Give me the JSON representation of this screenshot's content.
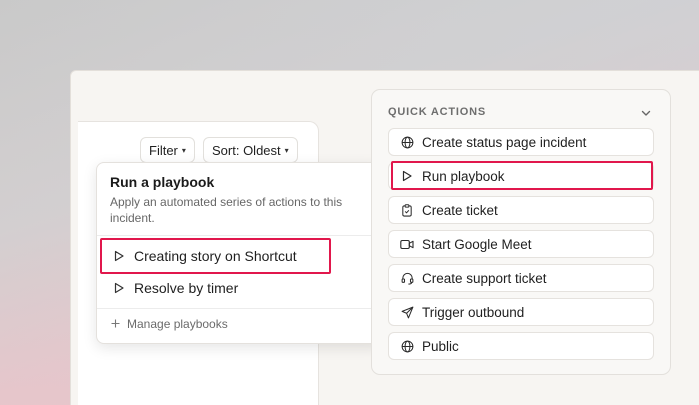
{
  "toolbar": {
    "filter_label": "Filter",
    "sort_label": "Sort: Oldest"
  },
  "playbook_menu": {
    "title": "Run a playbook",
    "description": "Apply an automated series of actions to this incident.",
    "items": [
      {
        "label": "Creating story on Shortcut",
        "icon": "play-icon"
      },
      {
        "label": "Resolve by timer",
        "icon": "play-icon"
      }
    ],
    "manage_label": "Manage playbooks"
  },
  "quick_actions": {
    "header": "QUICK ACTIONS",
    "items": [
      {
        "label": "Create status page incident",
        "icon": "globe-icon"
      },
      {
        "label": "Run playbook",
        "icon": "play-icon"
      },
      {
        "label": "Create ticket",
        "icon": "clipboard-icon"
      },
      {
        "label": "Start Google Meet",
        "icon": "video-icon"
      },
      {
        "label": "Create support ticket",
        "icon": "headset-icon"
      },
      {
        "label": "Trigger outbound",
        "icon": "send-icon"
      },
      {
        "label": "Public",
        "icon": "globe-icon"
      }
    ]
  },
  "colors": {
    "highlight": "#e1174c",
    "panel_bg": "#f7f5f2"
  }
}
